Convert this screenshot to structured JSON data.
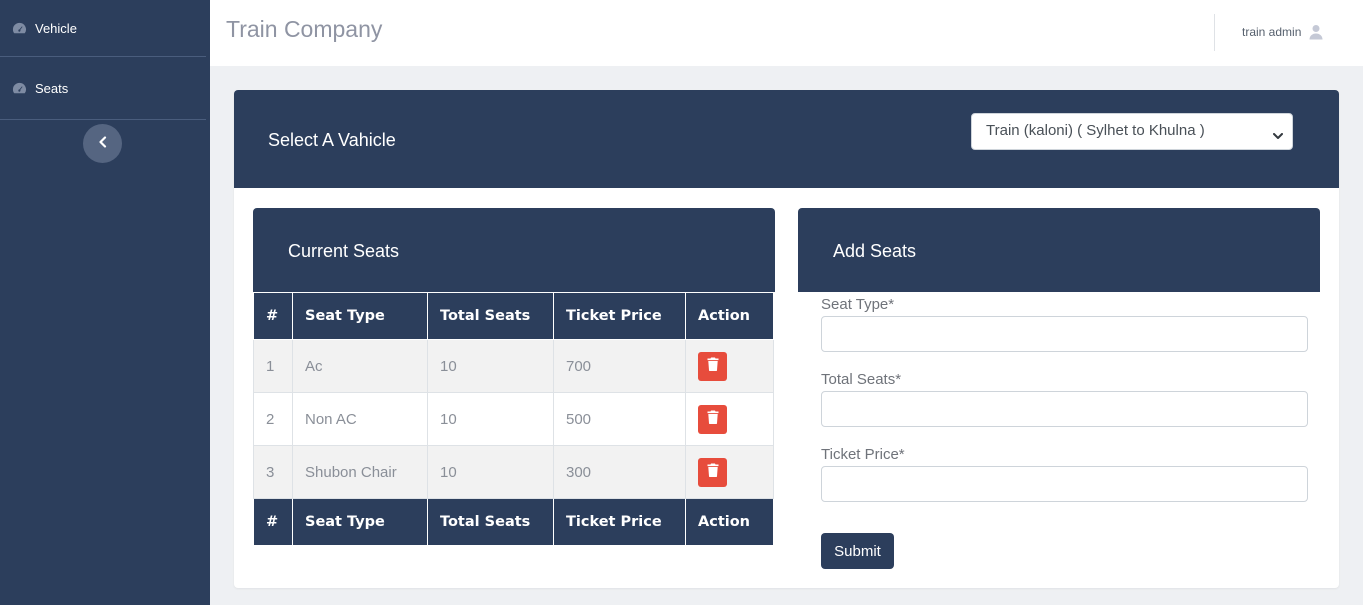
{
  "sidebar": {
    "items": [
      {
        "label": "Vehicle",
        "icon": "dashboard-gauge-icon"
      },
      {
        "label": "Seats",
        "icon": "dashboard-gauge-icon"
      }
    ],
    "collapse_icon": "chevron-left-icon"
  },
  "header": {
    "brand": "Train Company",
    "user_name": "train admin",
    "user_icon": "user-icon"
  },
  "vehicle_select": {
    "title": "Select A Vahicle",
    "selected": "Train (kaloni) ( Sylhet to Khulna )"
  },
  "current_seats": {
    "title": "Current Seats",
    "columns": [
      "#",
      "Seat Type",
      "Total Seats",
      "Ticket Price",
      "Action"
    ],
    "rows": [
      {
        "num": "1",
        "seat_type": "Ac",
        "total_seats": "10",
        "ticket_price": "700"
      },
      {
        "num": "2",
        "seat_type": "Non AC",
        "total_seats": "10",
        "ticket_price": "500"
      },
      {
        "num": "3",
        "seat_type": "Shubon Chair",
        "total_seats": "10",
        "ticket_price": "300"
      }
    ],
    "delete_icon": "trash-icon"
  },
  "add_seats": {
    "title": "Add Seats",
    "seat_type_label": "Seat Type*",
    "total_seats_label": "Total Seats*",
    "ticket_price_label": "Ticket Price*",
    "submit_label": "Submit"
  },
  "colors": {
    "navy": "#2c3e5c",
    "danger": "#e74c3c",
    "background": "#eef0f3"
  }
}
